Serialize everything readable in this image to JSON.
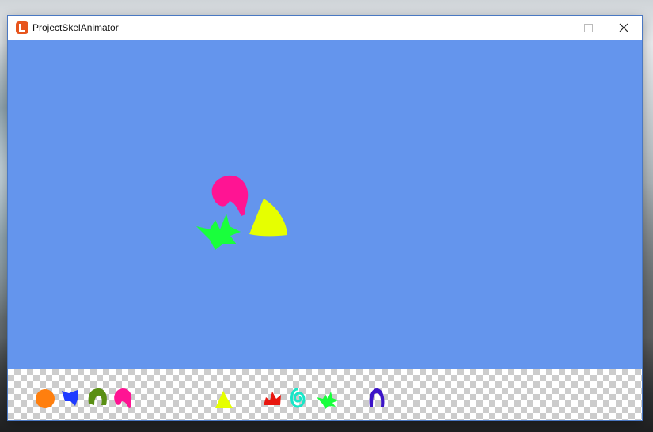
{
  "window": {
    "title": "ProjectSkelAnimator",
    "icon": "monogame-icon",
    "controls": [
      "minimize-icon",
      "maximize-icon",
      "close-icon"
    ]
  },
  "viewport": {
    "background_color": "#6495ed",
    "parts": [
      {
        "name": "magenta-head-part",
        "color": "#ff1493"
      },
      {
        "name": "yellow-triangle-part",
        "color": "#e6ff00"
      },
      {
        "name": "green-spiky-part",
        "color": "#19ff3c"
      }
    ]
  },
  "sprite_sheet": {
    "items": [
      {
        "name": "orange-circle-sprite",
        "color": "#ff7f0e"
      },
      {
        "name": "blue-arrow-sprite",
        "color": "#1f3bff"
      },
      {
        "name": "olive-arch-sprite",
        "color": "#5a8f14"
      },
      {
        "name": "magenta-head-sprite",
        "color": "#ff1493"
      },
      {
        "name": "yellow-triangle-sprite",
        "color": "#e6ff00"
      },
      {
        "name": "red-crown-sprite",
        "color": "#e8170f"
      },
      {
        "name": "cyan-spiral-sprite",
        "color": "#19e6c8"
      },
      {
        "name": "green-spiky-sprite",
        "color": "#19ff3c"
      },
      {
        "name": "indigo-arch-sprite",
        "color": "#3c14c8"
      }
    ]
  }
}
